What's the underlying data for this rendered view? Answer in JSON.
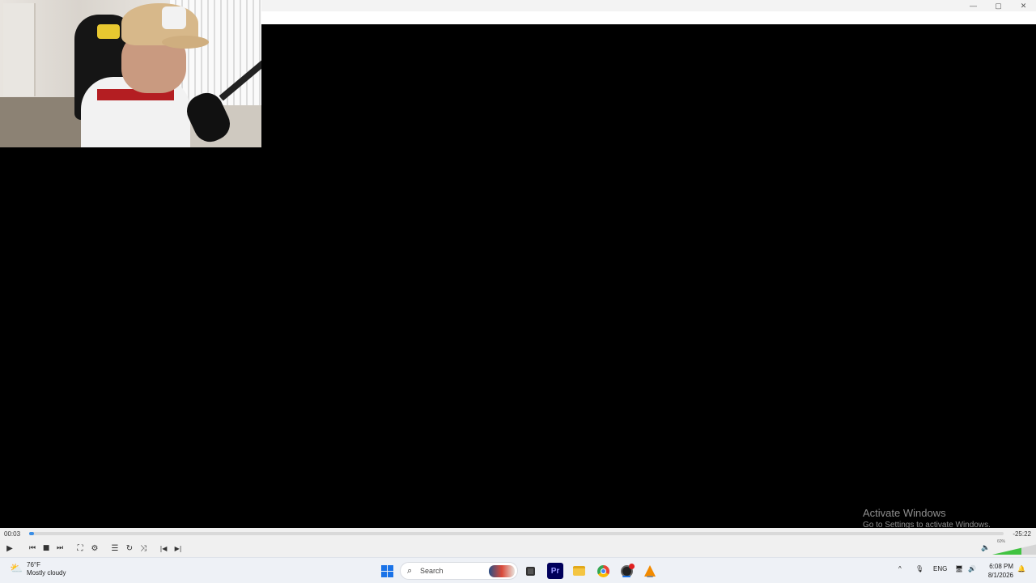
{
  "window": {
    "controls": {
      "minimize": "—",
      "maximize": "▢",
      "close": "✕"
    }
  },
  "player": {
    "elapsed": "00:03",
    "remaining": "-25:22",
    "progress_fraction": 0.002,
    "volume_percent_label": "60%",
    "volume_fraction": 0.6,
    "controls": {
      "play": "▶",
      "previous": "⏮",
      "stop": "■",
      "next": "⏭",
      "fullscreen": "⛶",
      "extended_settings": "⚙",
      "playlist": "☰",
      "loop": "↻",
      "shuffle": "⤨",
      "frame_back": "|◀",
      "frame_next": "▶|",
      "speaker": "🔈"
    },
    "accent_color": "#41c341"
  },
  "watermark": {
    "title": "Activate Windows",
    "subtitle": "Go to Settings to activate Windows."
  },
  "taskbar": {
    "weather": {
      "temperature": "76°F",
      "condition": "Mostly cloudy",
      "icon": "cloud-sun-icon"
    },
    "search_label": "Search",
    "apps": [
      "task-view",
      "premiere-pro",
      "file-explorer",
      "chrome",
      "obs",
      "vlc"
    ],
    "premiere_label": "Pr",
    "tray": {
      "chevron": "^",
      "mic": "🎙",
      "language": "ENG",
      "network": "🖥",
      "volume": "🔊",
      "notification": "🔔"
    },
    "time": "6:08 PM",
    "date": "8/1/2026"
  }
}
